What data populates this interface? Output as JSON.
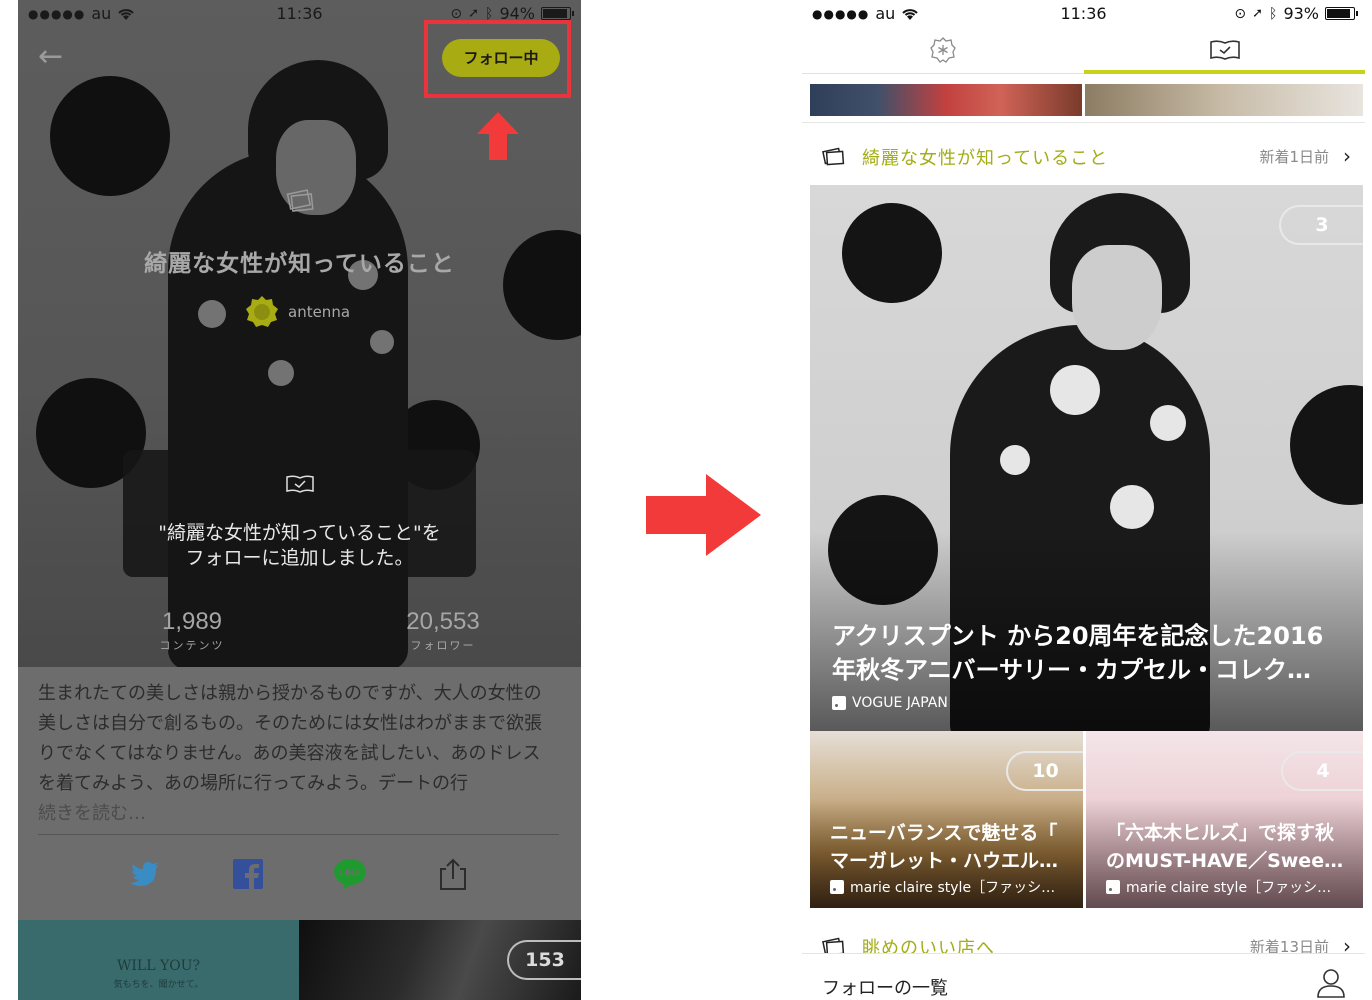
{
  "left_screen": {
    "status": {
      "signal": "●●●●●",
      "carrier": "au",
      "time": "11:36",
      "battery": "94%",
      "battery_level": 0.94
    },
    "follow_button_label": "フォロー中",
    "category_title": "綺麗な女性が知っていること",
    "author_name": "antenna",
    "toast": {
      "line1": "\"綺麗な女性が知っていること\"を",
      "line2": "フォローに追加しました。"
    },
    "stats": {
      "contents_count": "1,989",
      "contents_label": "コンテンツ",
      "followers_count": "20,553",
      "followers_label": "フォロワー"
    },
    "description": "生まれたての美しさは親から授かるものですが、大人の女性の美しさは自分で創るもの。そのためには女性はわがままで欲張りでなくてはなりません。あの美容液を試したい、あのドレスを着てみよう、あの場所に行ってみよう。デートの行",
    "read_more": "続きを読む…",
    "share_icons": [
      "twitter-icon",
      "facebook-icon",
      "line-icon",
      "share-icon"
    ],
    "bottom_tile": {
      "line1": "WILL YOU?",
      "line2": "気もちを、聞かせて。",
      "count": "153"
    }
  },
  "right_screen": {
    "status": {
      "signal": "●●●●●",
      "carrier": "au",
      "time": "11:36",
      "battery": "93%",
      "battery_level": 0.93
    },
    "category1": {
      "title": "綺麗な女性が知っていること",
      "meta": "新着1日前"
    },
    "feature": {
      "count": "3",
      "title_line1": "アクリスプント から20周年を記念した2016",
      "title_line2": "年秋冬アニバーサリー・カプセル・コレク…",
      "source": "VOGUE JAPAN"
    },
    "sub_cards": [
      {
        "count": "10",
        "title_line1": "ニューバランスで魅せる「",
        "title_line2": "マーガレット・ハウエル…",
        "source": "marie claire style［ファッシ…"
      },
      {
        "count": "4",
        "title_line1": "「六本木ヒルズ」で探す秋",
        "title_line2": "のMUST-HAVE／Swee…",
        "source": "marie claire style［ファッシ…"
      }
    ],
    "category2": {
      "title": "眺めのいい店へ",
      "meta": "新着13日前"
    },
    "bottom_bar_label": "フォローの一覧"
  },
  "colors": {
    "accent_lime": "#a9ab12",
    "highlight_red": "#e8343a",
    "arrow_red": "#f23a3a",
    "tab_underline": "#c7d31a"
  }
}
